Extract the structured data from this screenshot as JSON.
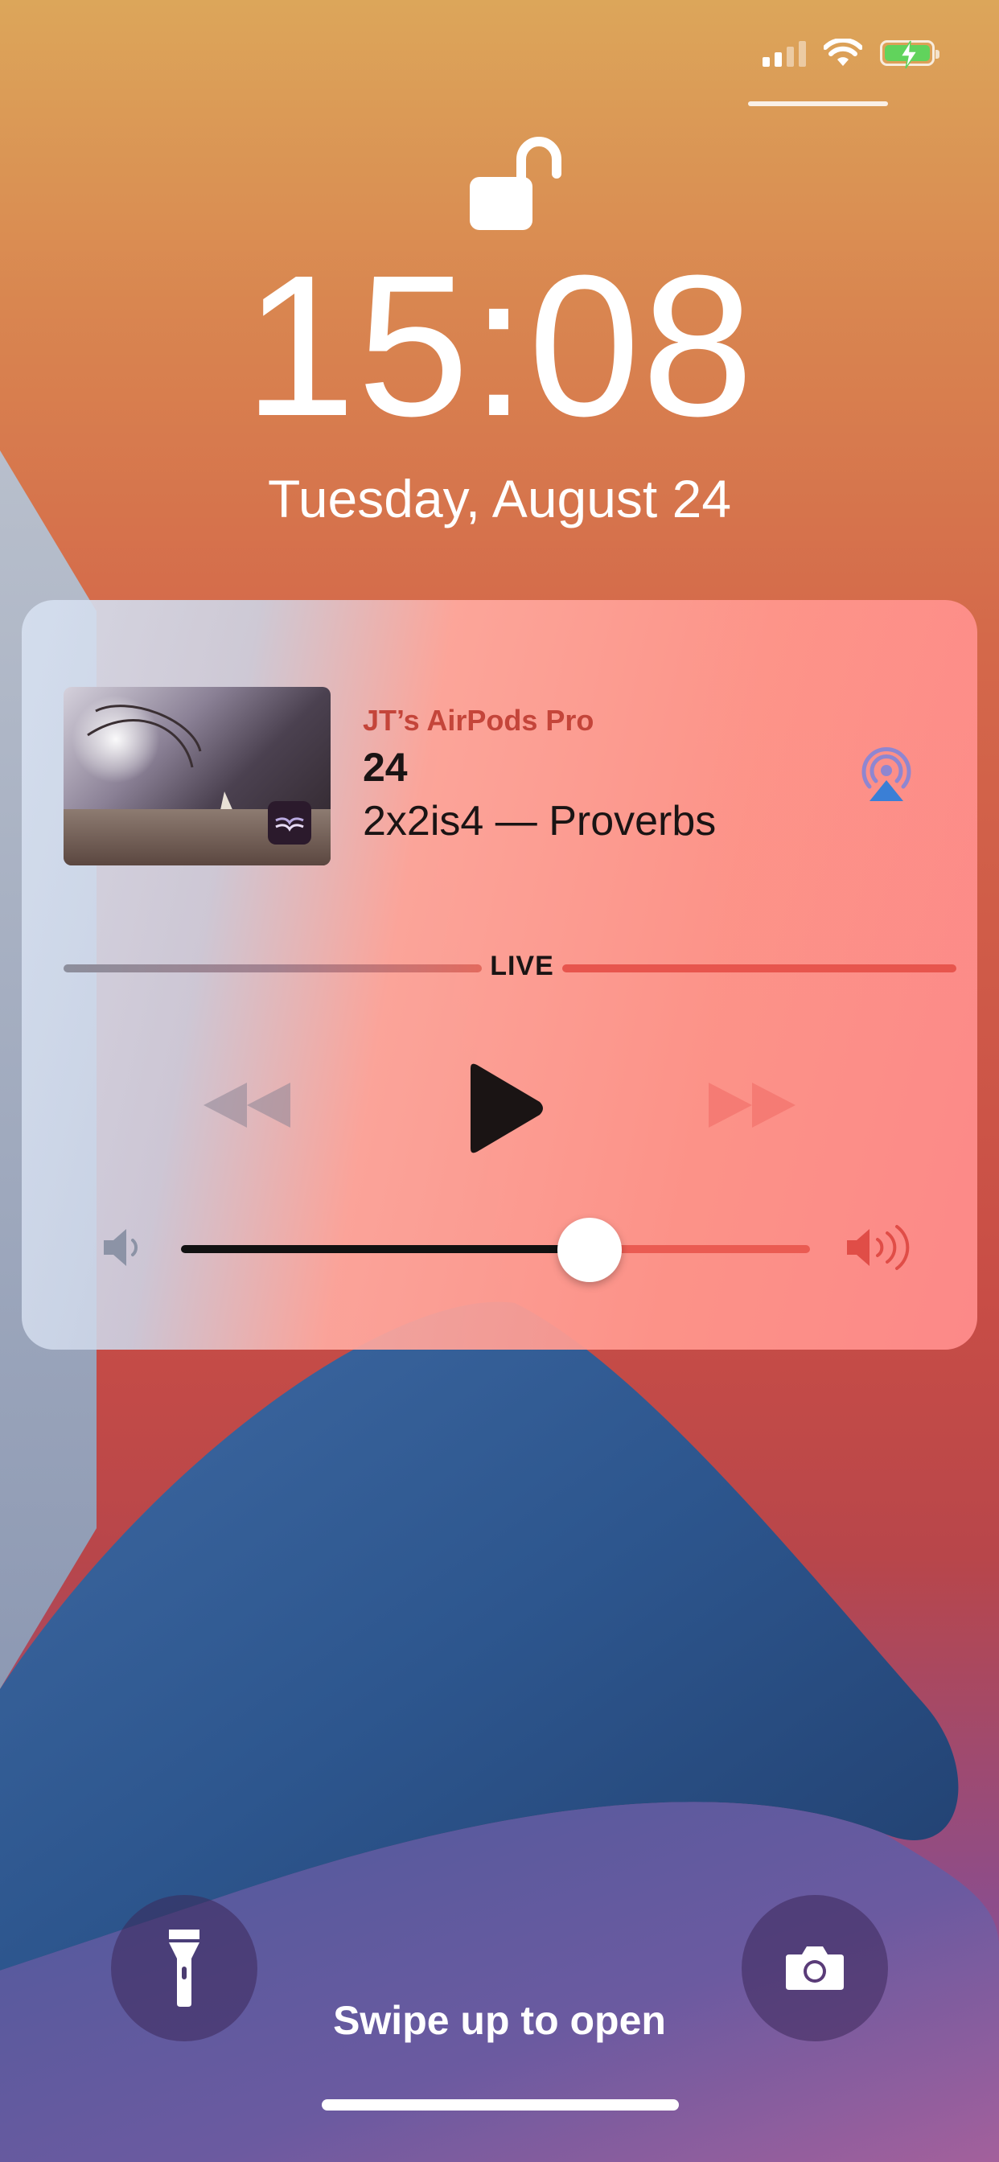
{
  "status_bar": {
    "signal_icon": "cellular-signal-icon",
    "wifi_icon": "wifi-icon",
    "battery_icon": "battery-charging-icon",
    "battery_color": "#61d35c"
  },
  "lock_screen": {
    "lock_icon": "unlocked-padlock-icon",
    "time": "15:08",
    "date": "Tuesday, August 24"
  },
  "now_playing": {
    "output_device": "JT’s AirPods Pro",
    "title": "24",
    "subtitle": "2x2is4 — Proverbs",
    "airplay_icon": "airplay-audio-icon",
    "progress_label": "LIVE",
    "controls": {
      "rewind_icon": "rewind-icon",
      "play_icon": "play-icon",
      "forward_icon": "fast-forward-icon"
    },
    "volume": {
      "level": 0.65,
      "low_icon": "volume-low-icon",
      "high_icon": "volume-high-icon"
    },
    "accent_color": "#c4453a"
  },
  "quick_actions": {
    "flashlight_icon": "flashlight-icon",
    "camera_icon": "camera-icon"
  },
  "footer": {
    "swipe_text": "Swipe up to open"
  }
}
